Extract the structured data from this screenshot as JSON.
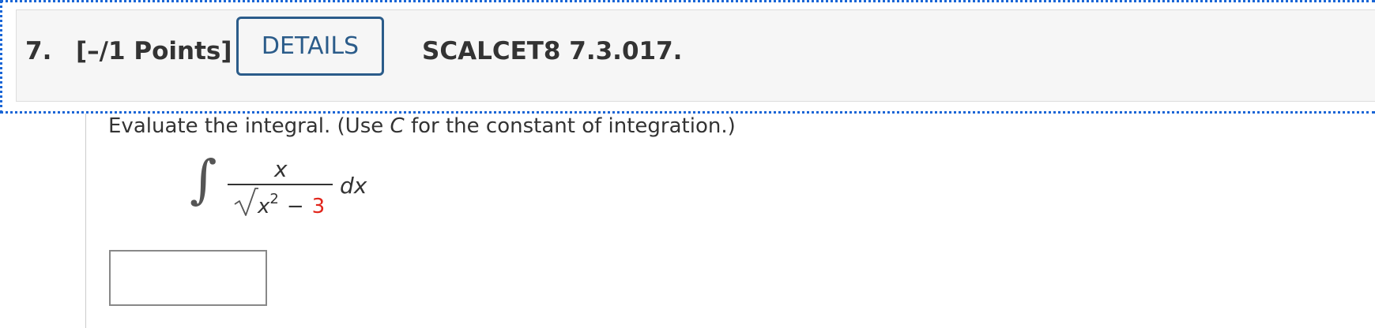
{
  "question": {
    "number": "7.",
    "points": "[–/1 Points]",
    "details_label": "DETAILS",
    "code": "SCALCET8 7.3.017."
  },
  "prompt": {
    "before": "Evaluate the integral. (Use ",
    "variable": "C",
    "after": " for the constant of integration.)"
  },
  "integral": {
    "sign": "∫",
    "numerator": "x",
    "denominator_var": "x",
    "denominator_exp": "2",
    "denominator_op": "−",
    "denominator_const": "3",
    "differential": "dx",
    "highlight_color": "#e1251b"
  },
  "answer": {
    "value": "",
    "placeholder": ""
  },
  "colors": {
    "focus_outline": "#1a66d6",
    "button_border": "#2b5c8a",
    "header_bg": "#f6f6f6"
  }
}
